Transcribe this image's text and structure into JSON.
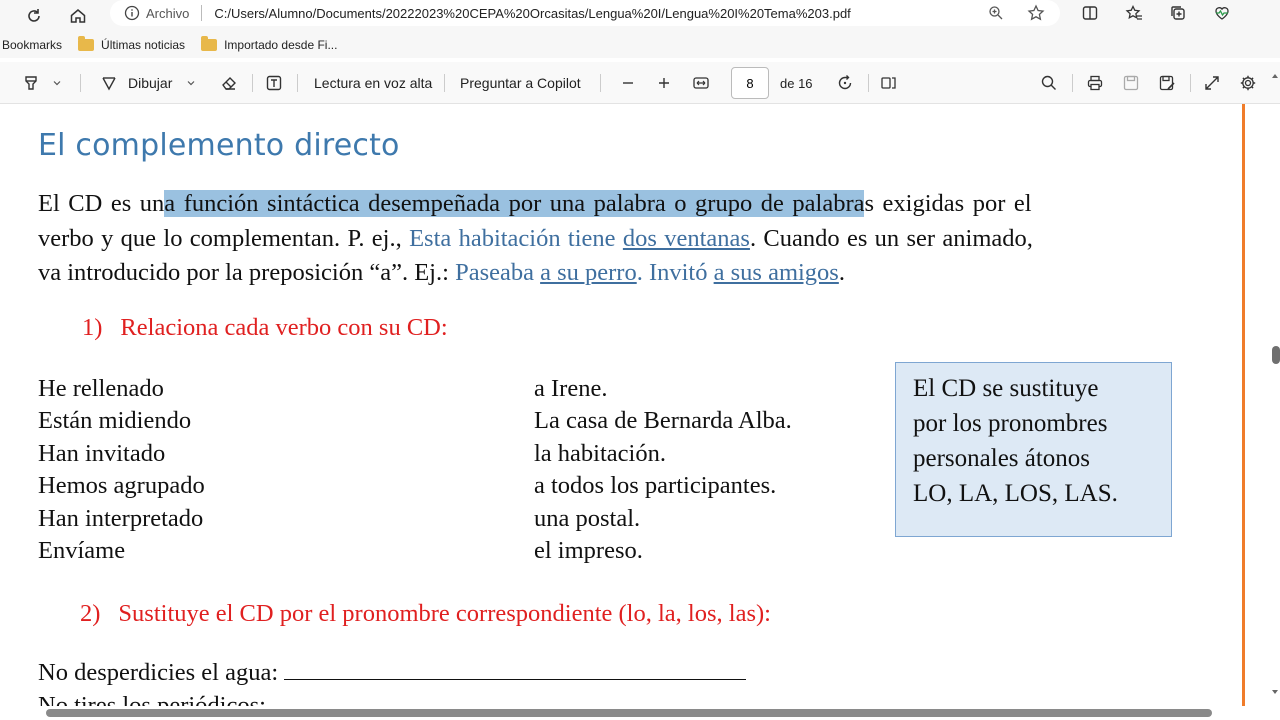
{
  "browser": {
    "archivo_label": "Archivo",
    "url": "C:/Users/Alumno/Documents/20222023%20CEPA%20Orcasitas/Lengua%20I/Lengua%20I%20Tema%203.pdf",
    "bookmarks": [
      "Bookmarks",
      "Últimas noticias",
      "Importado desde Fi..."
    ]
  },
  "pdf_toolbar": {
    "draw_label": "Dibujar",
    "read_aloud_label": "Lectura en voz alta",
    "copilot_label": "Preguntar a Copilot",
    "current_page": "8",
    "page_total": "de 16"
  },
  "doc": {
    "title": "El complemento directo",
    "para": {
      "l1_a": "El CD es un",
      "l1_hl": "a función sintáctica desempeñada por una palabra o grupo de palabra",
      "l1_b": "s exigidas por el",
      "l2_a": "verbo y que lo complementan. P. ej., ",
      "l2_blue": "Esta habitación tiene ",
      "l2_ul": "dos ventanas",
      "l2_b": ". Cuando es un ser animado,",
      "l3_a": "va introducido por la preposición “a”. Ej.: ",
      "l3_blue1": "Paseaba ",
      "l3_ul1": "a su perro",
      "l3_blue2": ". Invitó ",
      "l3_ul2": "a sus amigos",
      "l3_b": "."
    },
    "ex1": {
      "num": "1)",
      "text": "Relaciona cada verbo con su CD:"
    },
    "verbs": [
      "He rellenado",
      "Están midiendo",
      "Han invitado",
      "Hemos agrupado",
      "Han interpretado",
      "Envíame"
    ],
    "objects": [
      "a Irene.",
      "La casa de Bernarda Alba.",
      "la habitación.",
      "a todos los participantes.",
      "una postal.",
      "el impreso."
    ],
    "box_lines": [
      "El CD se sustituye",
      "por los pronombres",
      "personales átonos",
      "LO, LA, LOS, LAS."
    ],
    "ex2": {
      "num": "2)",
      "text": "Sustituye el CD por el pronombre correspondiente (lo, la, los, las):"
    },
    "sentence1": "No desperdicies el agua:",
    "sentence2": "No tires los periódicos:"
  }
}
